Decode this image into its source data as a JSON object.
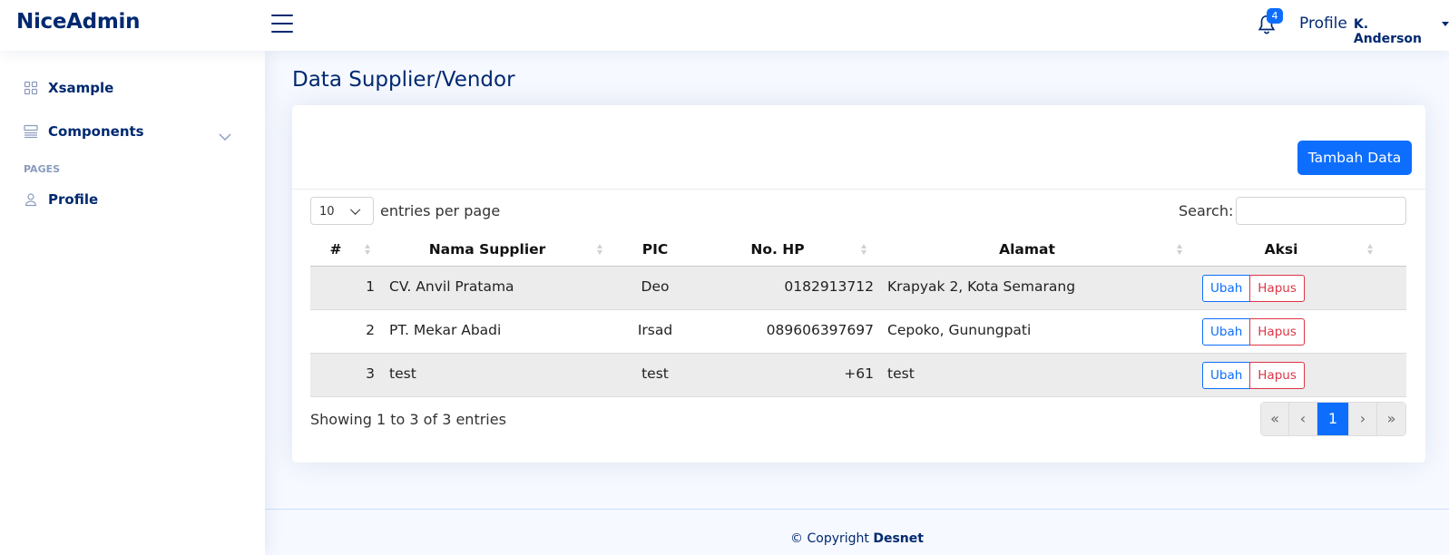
{
  "header": {
    "logo": "NiceAdmin",
    "notification_count": "4",
    "profile_label": "Profile",
    "user_name": "K. Anderson"
  },
  "sidebar": {
    "items": [
      {
        "label": "Xsample",
        "icon": "grid-icon"
      },
      {
        "label": "Components",
        "icon": "menu-button-icon"
      }
    ],
    "pages_heading": "PAGES",
    "pages": [
      {
        "label": "Profile",
        "icon": "person-icon"
      }
    ]
  },
  "main": {
    "title": "Data Supplier/Vendor",
    "add_button": "Tambah Data",
    "entries_select_value": "10",
    "entries_label": "entries per page",
    "search_label": "Search:",
    "columns": [
      "#",
      "Nama Supplier",
      "PIC",
      "No. HP",
      "Alamat",
      "Aksi"
    ],
    "rows": [
      {
        "no": "1",
        "nama": "CV. Anvil Pratama",
        "pic": "Deo",
        "hp": "0182913712",
        "alamat": "Krapyak 2, Kota Semarang"
      },
      {
        "no": "2",
        "nama": "PT. Mekar Abadi",
        "pic": "Irsad",
        "hp": "089606397697",
        "alamat": "Cepoko, Gunungpati"
      },
      {
        "no": "3",
        "nama": "test",
        "pic": "test",
        "hp": "+61",
        "alamat": "test"
      }
    ],
    "edit_label": "Ubah",
    "delete_label": "Hapus",
    "info": "Showing 1 to 3 of 3 entries",
    "pagination": [
      "«",
      "‹",
      "1",
      "›",
      "»"
    ]
  },
  "footer": {
    "copyright": "© Copyright",
    "brand": "Desnet"
  },
  "colors": {
    "primary": "#0d6efd",
    "navy": "#012970",
    "danger": "#dc3545",
    "background": "#f6f9ff"
  }
}
